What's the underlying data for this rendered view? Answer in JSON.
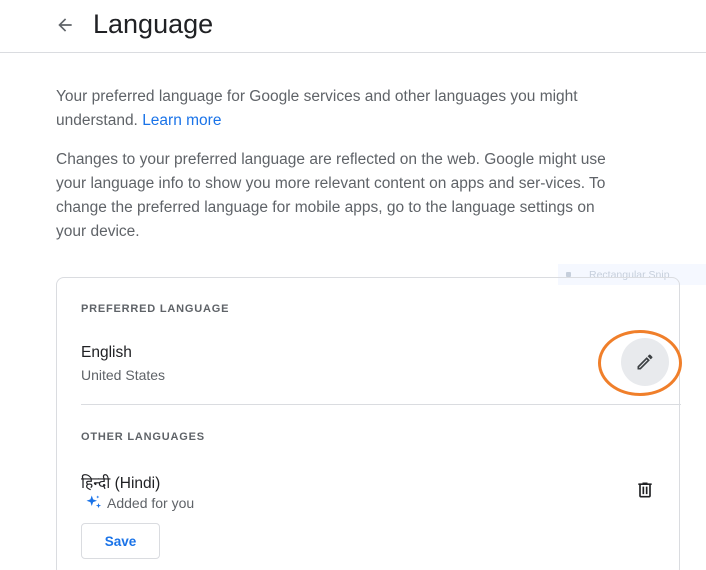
{
  "header": {
    "title": "Language",
    "back_icon": "arrow-left-icon"
  },
  "intro": {
    "paragraph1_text": "Your preferred language for Google services and other languages you might understand.",
    "paragraph1_link": "Learn more",
    "paragraph2_text": "Changes to your preferred language are reflected on the web. Google might use your language info to show you more relevant content on apps and ser-vices. To change the preferred language for mobile apps, go to the language settings on your device."
  },
  "preferred": {
    "section_label": "PREFERRED LANGUAGE",
    "language": "English",
    "region": "United States",
    "edit_icon": "pencil-icon"
  },
  "other": {
    "section_label": "OTHER LANGUAGES",
    "language": "हिन्दी (Hindi)",
    "added_note": "Added for you",
    "added_icon": "sparkle-icon",
    "delete_icon": "trash-icon",
    "save_label": "Save"
  },
  "overlay": {
    "snip_text": "Rectangular Snip"
  },
  "colors": {
    "accent": "#1a73e8",
    "highlight_ring": "#f07f2a",
    "border": "#dadce0",
    "muted_text": "#5f6368"
  }
}
